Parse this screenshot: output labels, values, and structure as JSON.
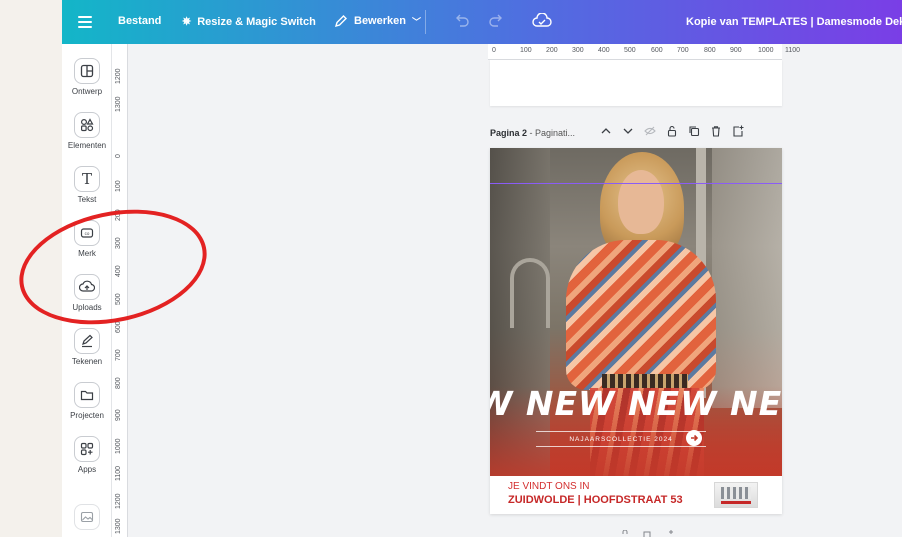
{
  "topbar": {
    "bestand": "Bestand",
    "resize": "Resize & Magic Switch",
    "bewerken": "Bewerken",
    "title": "Kopie van TEMPLATES | Damesmode Dekk"
  },
  "sidebar": {
    "items": [
      {
        "label": "Ontwerp",
        "icon": "layout-icon"
      },
      {
        "label": "Elementen",
        "icon": "elements-icon"
      },
      {
        "label": "Tekst",
        "icon": "text-icon"
      },
      {
        "label": "Merk",
        "icon": "brand-icon"
      },
      {
        "label": "Uploads",
        "icon": "upload-icon"
      },
      {
        "label": "Tekenen",
        "icon": "draw-icon"
      },
      {
        "label": "Projecten",
        "icon": "folder-icon"
      },
      {
        "label": "Apps",
        "icon": "apps-icon"
      }
    ]
  },
  "rulers": {
    "horizontal": [
      "0",
      "100",
      "200",
      "300",
      "400",
      "500",
      "600",
      "700",
      "800",
      "900",
      "1000",
      "1100"
    ],
    "vertical_top": [
      "1200",
      "1300"
    ],
    "vertical": [
      "0",
      "100",
      "200",
      "300",
      "400",
      "500",
      "600",
      "700",
      "800",
      "900",
      "1000",
      "1100",
      "1200",
      "1300"
    ]
  },
  "page2": {
    "label": "Pagina 2",
    "subtitle": "Paginati..."
  },
  "poster": {
    "headline": "W NEW NEW NEW",
    "cta": "NAJAARSCOLLECTIE 2024",
    "footer_line1": "JE VINDT ONS IN",
    "footer_line2": "ZUIDWOLDE | HOOFDSTRAAT 53"
  },
  "colors": {
    "accent": "#e32222",
    "topbar_start": "#13b6c8",
    "topbar_end": "#7a3ee6",
    "footer_red": "#c62828"
  }
}
